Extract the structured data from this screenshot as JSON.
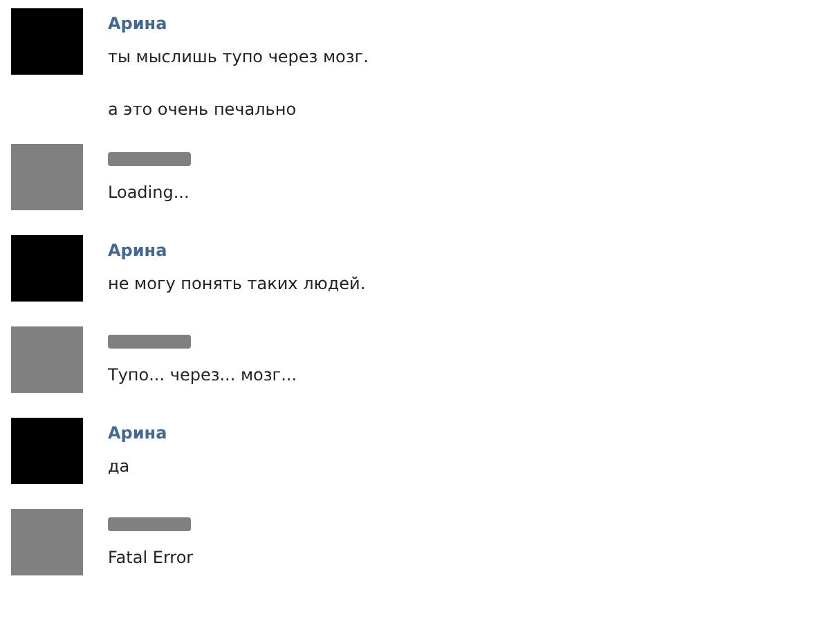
{
  "messages": [
    {
      "sender": "Арина",
      "color": "#000000",
      "lines": [
        "ты мыслишь тупо через мозг.",
        "а это очень печально"
      ]
    },
    {
      "color": "#808080",
      "lines": [
        "Loading..."
      ]
    },
    {
      "sender": "Арина",
      "color": "#000000",
      "lines": [
        "не могу понять таких людей."
      ]
    },
    {
      "color": "#808080",
      "lines": [
        "Тупо... через... мозг..."
      ]
    },
    {
      "sender": "Арина",
      "color": "#000000",
      "lines": [
        "да"
      ]
    },
    {
      "color": "#808080",
      "lines": [
        "Fatal Error"
      ]
    }
  ]
}
